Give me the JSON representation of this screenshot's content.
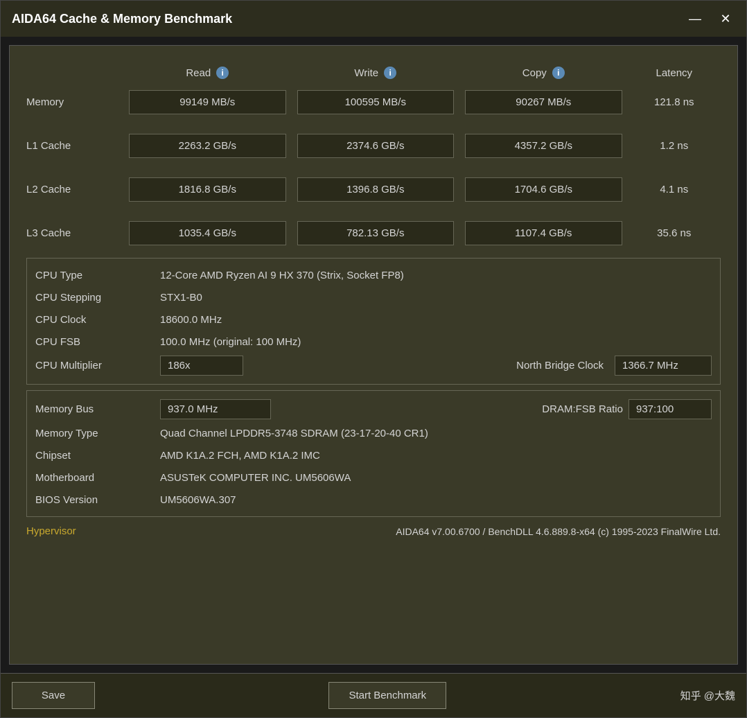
{
  "window": {
    "title": "AIDA64 Cache & Memory Benchmark",
    "minimize_label": "—",
    "close_label": "✕"
  },
  "columns": {
    "read": "Read",
    "write": "Write",
    "copy": "Copy",
    "latency": "Latency"
  },
  "rows": [
    {
      "label": "Memory",
      "read": "99149 MB/s",
      "write": "100595 MB/s",
      "copy": "90267 MB/s",
      "latency": "121.8 ns"
    },
    {
      "label": "L1 Cache",
      "read": "2263.2 GB/s",
      "write": "2374.6 GB/s",
      "copy": "4357.2 GB/s",
      "latency": "1.2 ns"
    },
    {
      "label": "L2 Cache",
      "read": "1816.8 GB/s",
      "write": "1396.8 GB/s",
      "copy": "1704.6 GB/s",
      "latency": "4.1 ns"
    },
    {
      "label": "L3 Cache",
      "read": "1035.4 GB/s",
      "write": "782.13 GB/s",
      "copy": "1107.4 GB/s",
      "latency": "35.6 ns"
    }
  ],
  "cpu_info": {
    "cpu_type_label": "CPU Type",
    "cpu_type_value": "12-Core AMD Ryzen AI 9 HX 370  (Strix, Socket FP8)",
    "cpu_stepping_label": "CPU Stepping",
    "cpu_stepping_value": "STX1-B0",
    "cpu_clock_label": "CPU Clock",
    "cpu_clock_value": "18600.0 MHz",
    "cpu_fsb_label": "CPU FSB",
    "cpu_fsb_value": "100.0 MHz  (original: 100 MHz)",
    "cpu_multiplier_label": "CPU Multiplier",
    "cpu_multiplier_value": "186x",
    "north_bridge_clock_label": "North Bridge Clock",
    "north_bridge_clock_value": "1366.7 MHz"
  },
  "memory_info": {
    "memory_bus_label": "Memory Bus",
    "memory_bus_value": "937.0 MHz",
    "dram_fsb_label": "DRAM:FSB Ratio",
    "dram_fsb_value": "937:100",
    "memory_type_label": "Memory Type",
    "memory_type_value": "Quad Channel LPDDR5-3748 SDRAM  (23-17-20-40 CR1)",
    "chipset_label": "Chipset",
    "chipset_value": "AMD K1A.2 FCH, AMD K1A.2 IMC",
    "motherboard_label": "Motherboard",
    "motherboard_value": "ASUSTeK COMPUTER INC. UM5606WA",
    "bios_label": "BIOS Version",
    "bios_value": "UM5606WA.307"
  },
  "hypervisor": {
    "label": "Hypervisor",
    "value": "AIDA64 v7.00.6700 / BenchDLL 4.6.889.8-x64  (c) 1995-2023 FinalWire Ltd."
  },
  "footer": {
    "save_label": "Save",
    "benchmark_label": "Start Benchmark",
    "watermark": "知乎 @大魏"
  }
}
